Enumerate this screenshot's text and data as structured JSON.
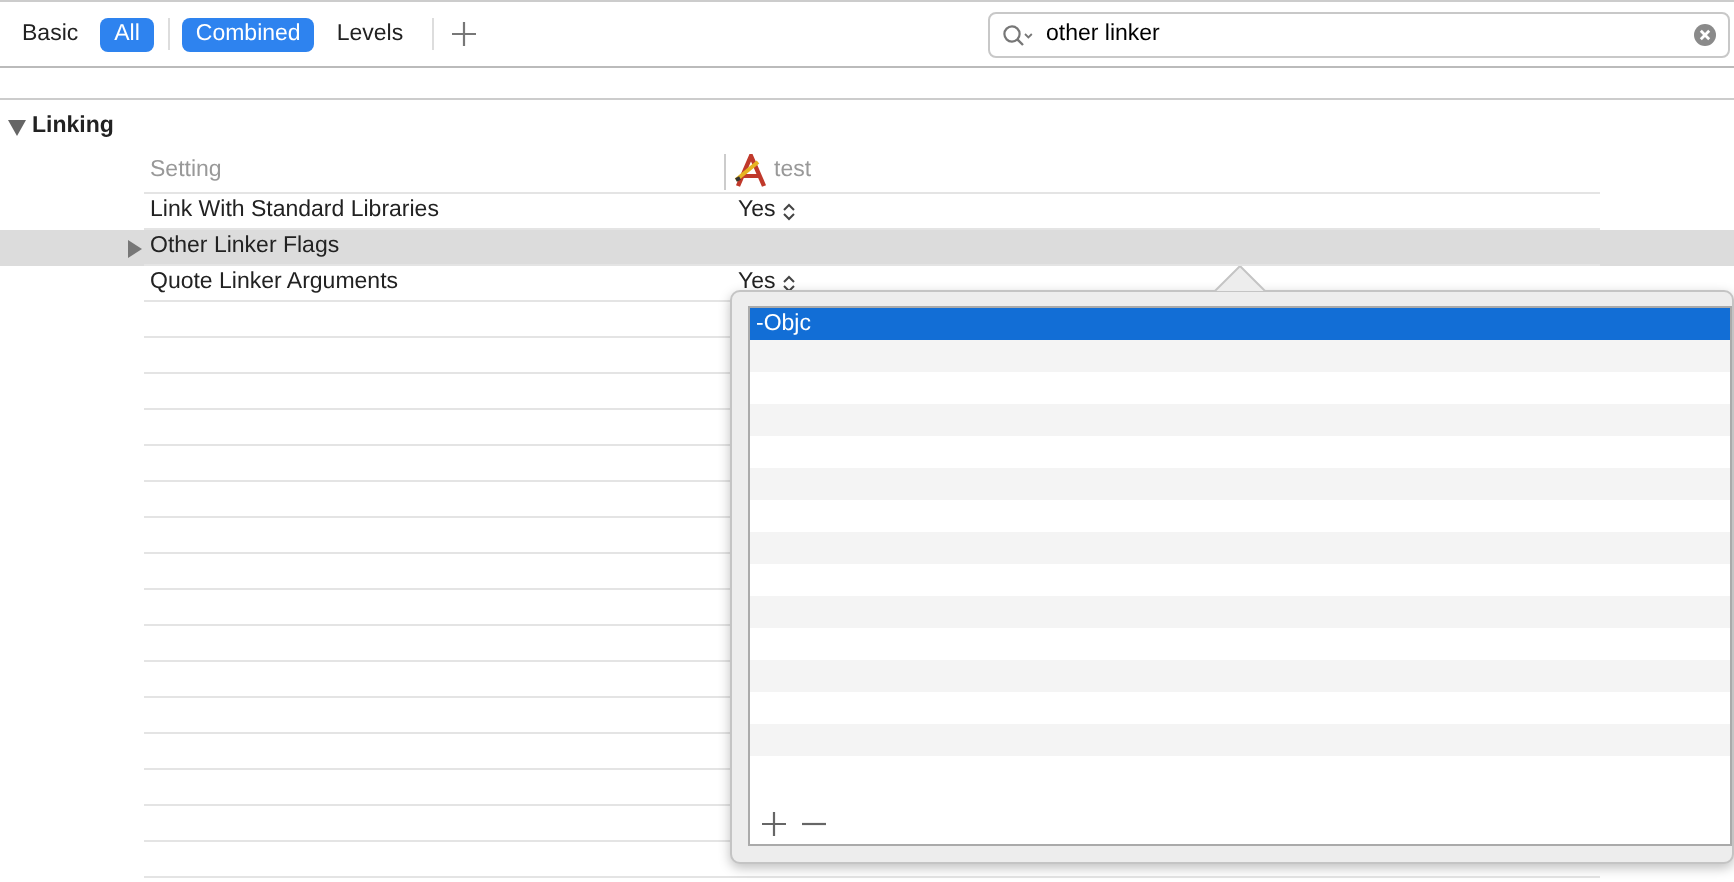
{
  "toolbar": {
    "scope_tabs": [
      {
        "label": "Basic",
        "selected": false
      },
      {
        "label": "All",
        "selected": true
      }
    ],
    "view_tabs": [
      {
        "label": "Combined",
        "selected": true
      },
      {
        "label": "Levels",
        "selected": false
      }
    ],
    "search": {
      "value": "other linker"
    }
  },
  "section": {
    "title": "Linking",
    "expanded": true,
    "columns": [
      "Setting",
      "test"
    ],
    "rows": [
      {
        "setting": "Link With Standard Libraries",
        "value": "Yes",
        "selected": false,
        "expandable": false
      },
      {
        "setting": "Other Linker Flags",
        "value": "",
        "selected": true,
        "expandable": true
      },
      {
        "setting": "Quote Linker Arguments",
        "value": "Yes",
        "selected": false,
        "expandable": false
      }
    ]
  },
  "popover": {
    "items": [
      {
        "value": "-Objc",
        "selected": true
      }
    ]
  }
}
